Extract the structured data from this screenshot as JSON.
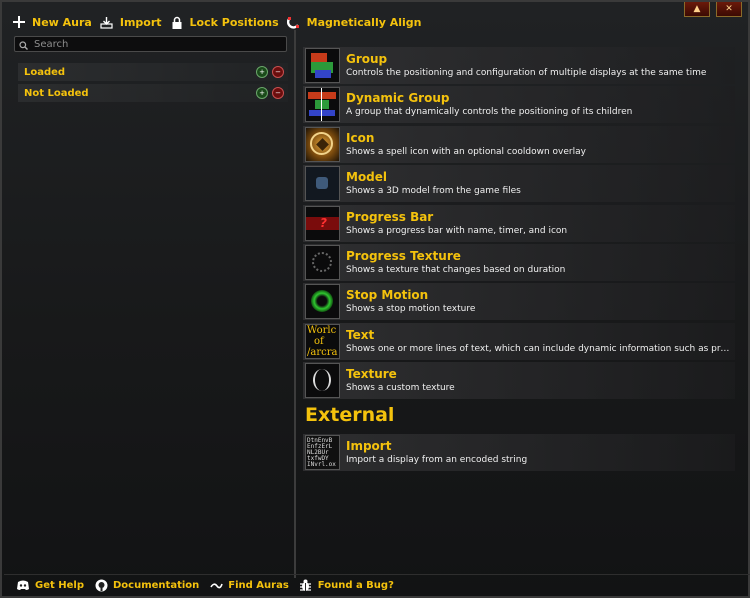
{
  "toolbar": {
    "new_aura": "New Aura",
    "import": "Import",
    "lock_positions": "Lock Positions",
    "magnetically_align": "Magnetically Align"
  },
  "window_buttons": {
    "minimize": "▲",
    "close": "✕"
  },
  "search": {
    "placeholder": "Search"
  },
  "tree": [
    {
      "label": "Loaded"
    },
    {
      "label": "Not Loaded"
    }
  ],
  "options": [
    {
      "title": "Group",
      "desc": "Controls the positioning and configuration of multiple displays at the same time"
    },
    {
      "title": "Dynamic Group",
      "desc": "A group that dynamically controls the positioning of its children"
    },
    {
      "title": "Icon",
      "desc": "Shows a spell icon with an optional cooldown overlay"
    },
    {
      "title": "Model",
      "desc": "Shows a 3D model from the game files"
    },
    {
      "title": "Progress Bar",
      "desc": "Shows a progress bar with name, timer, and icon"
    },
    {
      "title": "Progress Texture",
      "desc": "Shows a texture that changes based on duration"
    },
    {
      "title": "Stop Motion",
      "desc": "Shows a stop motion texture"
    },
    {
      "title": "Text",
      "desc": "Shows one or more lines of text, which can include dynamic information such as progress..."
    },
    {
      "title": "Texture",
      "desc": "Shows a custom texture"
    }
  ],
  "text_thumb": {
    "l1": "Worlc",
    "l2": "of",
    "l3": "/arcra"
  },
  "import_thumb": {
    "l1": "DtnEnvB",
    "l2": "EnfzErL",
    "l3": "NL2BUr",
    "l4": "txfwDY",
    "l5": "INvrl.ox"
  },
  "external": {
    "section_title": "External",
    "import_title": "Import",
    "import_desc": "Import a display from an encoded string"
  },
  "footer": {
    "get_help": "Get Help",
    "documentation": "Documentation",
    "find_auras": "Find Auras",
    "found_bug": "Found a Bug?"
  },
  "colors": {
    "accent": "#f4c20d",
    "text": "#f0f0f0",
    "bg": "#1a1b1c"
  },
  "icons": [
    "plus-icon",
    "import-icon",
    "lock-icon",
    "magnet-icon",
    "search-icon",
    "discord-icon",
    "github-icon",
    "wago-icon",
    "bug-icon"
  ]
}
